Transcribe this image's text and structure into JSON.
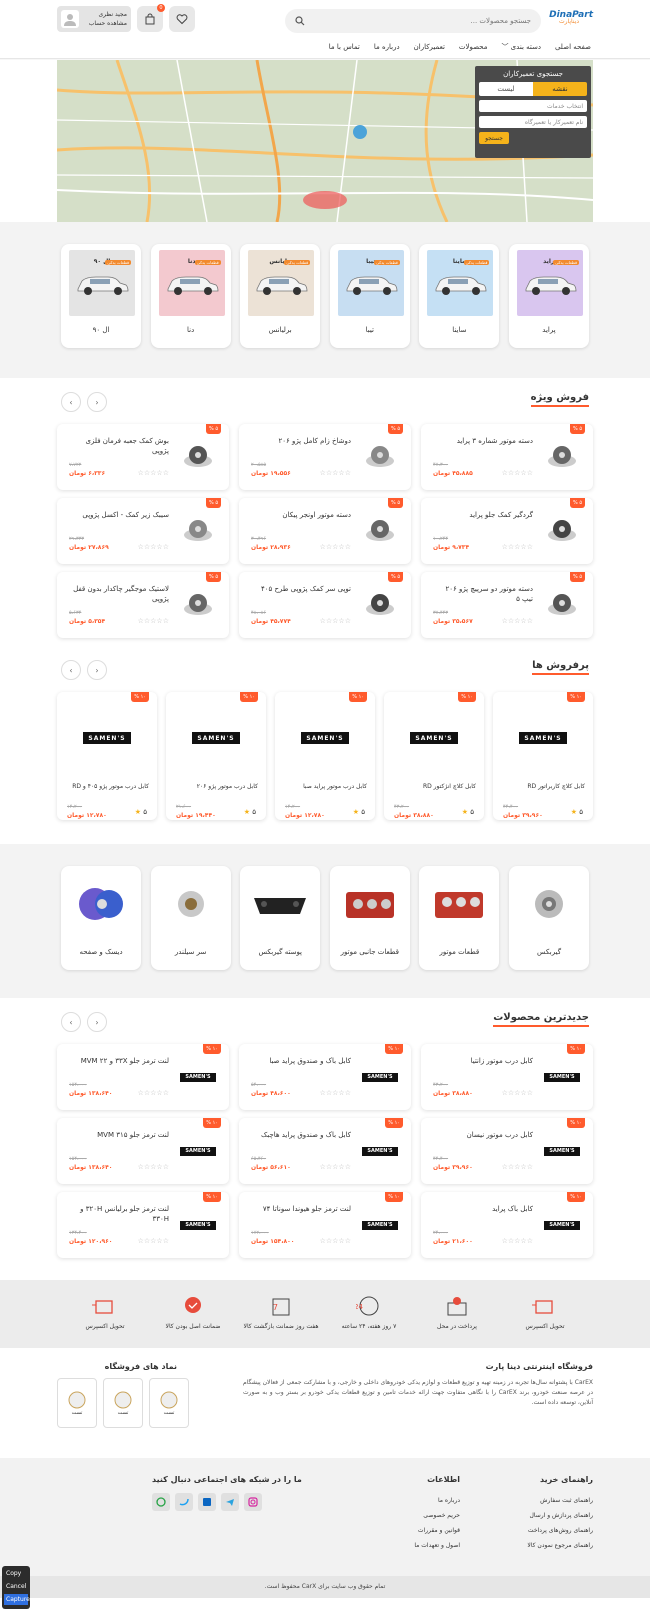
{
  "header": {
    "logo_main": "DinaPart",
    "logo_sub": "دیناپارت",
    "search_placeholder": "جستجو محصولات ...",
    "account_name": "مجید نظری",
    "account_sub": "مشاهده حساب",
    "cart_count": "0"
  },
  "nav": [
    "صفحه اصلی",
    "دسته بندی ﹀",
    "محصولات",
    "تعمیرکاران",
    "درباره ما",
    "تماس با ما"
  ],
  "map": {
    "panel_title": "جستجوی تعمیرکاران",
    "tab_map": "نقشه",
    "tab_list": "لیست",
    "service_placeholder": "انتخاب خدمات",
    "name_placeholder": "نام تعمیرکار یا تعمیرگاه",
    "search_btn": "جستجو"
  },
  "brands": [
    {
      "name": "پراید",
      "title": "پراید",
      "bg": "#d9c6ef"
    },
    {
      "name": "ساینا",
      "title": "ساینا",
      "bg": "#c5e0f4"
    },
    {
      "name": "تیبا",
      "title": "تیبا",
      "bg": "#c7def2"
    },
    {
      "name": "برلیانس",
      "title": "برلیانس",
      "bg": "#ece2d6"
    },
    {
      "name": "دنا",
      "title": "دنا",
      "bg": "#f3c9cf"
    },
    {
      "name": "ال ۹۰",
      "title": "ال ۹۰",
      "bg": "#e4e4e4"
    }
  ],
  "brand_tag": "قطعات یدکی",
  "special": {
    "title": "فروش ویژه",
    "badge": "۵ %",
    "currency": "تومان",
    "items": [
      {
        "name": "دسته موتور شماره ۳ پراید",
        "old": "۴۷،۳۰۰",
        "new": "۴۵،۸۸۵ تومان"
      },
      {
        "name": "دوشاخ زام کامل پژو ۲۰۶",
        "old": "۲۰،۵۸۵",
        "new": "۱۹،۵۵۶ تومان"
      },
      {
        "name": "بوش کمک جعبه فرمان فلزی پژوپی",
        "old": "۷،۷۲۲",
        "new": "۶،۳۳۶ تومان"
      },
      {
        "name": "گردگیر کمک جلو پراید",
        "old": "۱۰،۲۴۴",
        "new": "۹،۷۳۴ تومان"
      },
      {
        "name": "دسته موتور اونجر پیکان",
        "old": "۳۰،۴۹۶",
        "new": "۲۸،۹۳۶ تومان"
      },
      {
        "name": "سیبک زیر کمک - اکسل پژوپی",
        "old": "۲۹،۳۳۳",
        "new": "۲۷،۸۶۹ تومان"
      },
      {
        "name": "دسته موتور دو سرپیچ پژو ۲۰۶ تیپ ۵",
        "old": "۳۷،۴۴۳",
        "new": "۳۵،۵۶۷ تومان"
      },
      {
        "name": "توپی سر کمک پژوپی طرح ۴۰۵",
        "old": "۴۸،۰۸۶",
        "new": "۴۵،۷۷۴ تومان"
      },
      {
        "name": "لاستیک موجگیر چاکدار بدون قفل پژوپی",
        "old": "۵،۶۳۴",
        "new": "۵،۳۵۴ تومان"
      }
    ]
  },
  "bestsellers": {
    "title": "پرفروش ها",
    "badge": "۱۰ %",
    "brand": "SAMEN'S",
    "items": [
      {
        "name": "کابل کلاچ کاربراتور RD",
        "old": "۴۴،۴۰۰",
        "new": "۳۹،۹۶۰ تومان",
        "rating": "۵"
      },
      {
        "name": "کابل کلاچ انژکتور RD",
        "old": "۴۳،۲۰۰",
        "new": "۳۸،۸۸۰ تومان",
        "rating": "۵"
      },
      {
        "name": "کابل درب موتور پراید صبا",
        "old": "۱۴،۲۰۰",
        "new": "۱۲،۷۸۰ تومان",
        "rating": "۵"
      },
      {
        "name": "کابل درب موتور پژو ۲۰۶",
        "old": "۲۱،۶۰۰",
        "new": "۱۹،۴۴۰ تومان",
        "rating": "۵"
      },
      {
        "name": "کابل درب موتور پژو ۴۰۵ و RD",
        "old": "۱۴،۲۰۰",
        "new": "۱۲،۷۸۰ تومان",
        "rating": "۵"
      }
    ]
  },
  "categories": [
    {
      "name": "گیربکس"
    },
    {
      "name": "قطعات موتور"
    },
    {
      "name": "قطعات جانبی موتور"
    },
    {
      "name": "پوسته گیربکس"
    },
    {
      "name": "سر سیلندر"
    },
    {
      "name": "دیسک و صفحه"
    }
  ],
  "newest": {
    "title": "جدیدترین محصولات",
    "badge": "۱۰ %",
    "brand": "SAMEN'S",
    "items": [
      {
        "name": "کابل درب موتور زانتیا",
        "old": "۴۳،۲۰۰",
        "new": "۳۸،۸۸۰ تومان"
      },
      {
        "name": "کابل باک و صندوق پراید صبا",
        "old": "۵۴،۰۰۰",
        "new": "۴۸،۶۰۰ تومان"
      },
      {
        "name": "لنت ترمز جلو ۳۳X و MVM ۲۲",
        "old": "۱۵۴،۰۰۰",
        "new": "۱۳۸،۶۴۰ تومان"
      },
      {
        "name": "کابل درب موتور نیسان",
        "old": "۴۴،۴۰۰",
        "new": "۳۹،۹۶۰ تومان"
      },
      {
        "name": "کابل باک و صندوق پراید هاچبک",
        "old": "۶۵،۴۶۰",
        "new": "۵۶،۶۱۰ تومان"
      },
      {
        "name": "لنت ترمز جلو MVM ۳۱۵",
        "old": "۱۵۴،۰۰۰",
        "new": "۱۳۸،۶۴۰ تومان"
      },
      {
        "name": "کابل باک پراید",
        "old": "۲۴،۰۰۰",
        "new": "۲۱،۶۰۰ تومان"
      },
      {
        "name": "لنت ترمز جلو هیوندا سوناتا ۷۴",
        "old": "۱۷۲،۰۰۰",
        "new": "۱۵۴،۸۰۰ تومان"
      },
      {
        "name": "لنت ترمز جلو برلیانس ۳۲۰H و ۳۳۰H",
        "old": "۱۳۴،۴۰۰",
        "new": "۱۲۰،۹۶۰ تومان"
      }
    ]
  },
  "features": [
    {
      "label": "تحویل اکسپرس"
    },
    {
      "label": "پرداخت در محل"
    },
    {
      "label": "۷ روز هفته، ۲۴ ساعته"
    },
    {
      "label": "هفت روز ضمانت بازگشت کالا"
    },
    {
      "label": "ضمانت اصل بودن کالا"
    },
    {
      "label": "تحویل اکسپرس"
    }
  ],
  "about": {
    "title": "فروشگاه اینترنتی دینا پارت",
    "desc": "CarEX با پشتوانه سال‌ها تجربه در زمینه تهیه و توزیع قطعات و لوازم یدکی خودروهای داخلی و خارجی، و با مشارکت جمعی از فعالان پیشگام در عرصه صنعت خودرو، برند CarEX را با نگاهی متفاوت جهت ارائه خدمات تامین و توزیع قطعات یدکی خودرو بر بستر وب و به صورت آنلاین، توسعه داده است.",
    "trust_title": "نماد های فروشگاه",
    "trust_badges": [
      "تست",
      "تست",
      "تست"
    ]
  },
  "footer": {
    "guide_title": "راهنمای خرید",
    "guide": [
      "راهنمای ثبت سفارش",
      "راهنمای پردازش و ارسال",
      "راهنمای روش‌های پرداخت",
      "راهنمای مرجوع نمودن کالا"
    ],
    "info_title": "اطلاعات",
    "info": [
      "درباره ما",
      "حریم خصوصی",
      "قوانین و مقررات",
      "اصول و تعهدات ما"
    ],
    "social_title": "ما را در شبکه های اجتماعی دنبال کنید",
    "copyright": "تمام حقوق وب سایت برای CarX محفوظ است."
  },
  "controls": [
    "Copy",
    "Cancel",
    "Capture"
  ]
}
